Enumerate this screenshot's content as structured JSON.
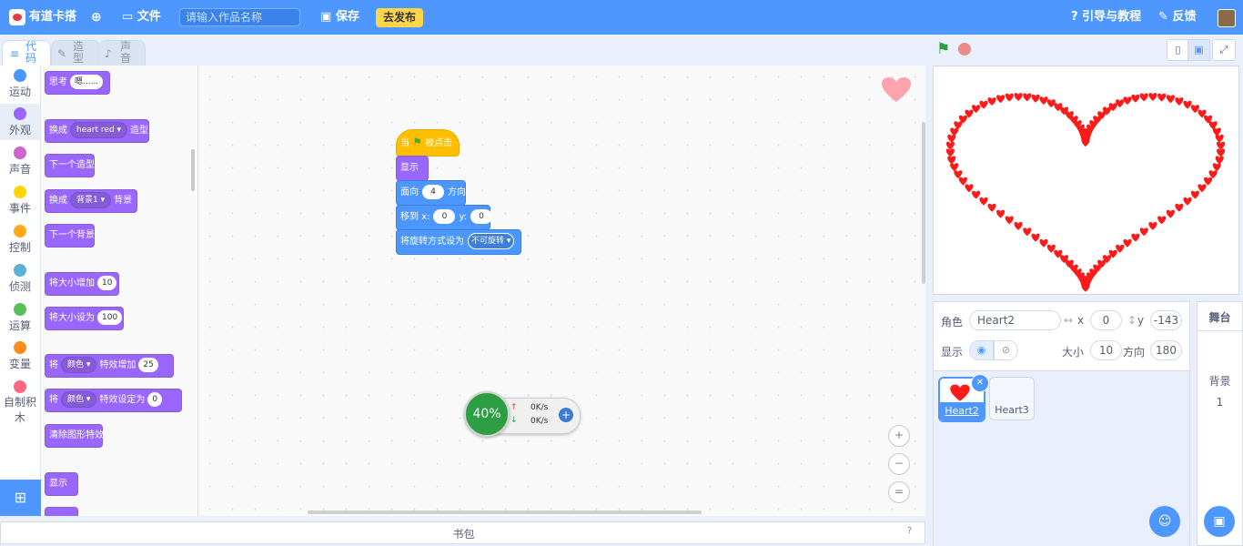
{
  "header": {
    "brand": "有道卡搭",
    "file_menu": "文件",
    "title_placeholder": "请输入作品名称",
    "save_label": "保存",
    "publish_label": "去发布",
    "tutorial_label": "引导与教程",
    "feedback_label": "反馈"
  },
  "tabs": [
    {
      "label": "代码"
    },
    {
      "label": "造型"
    },
    {
      "label": "声音"
    }
  ],
  "categories": [
    {
      "label": "运动",
      "color": "#4c97ff"
    },
    {
      "label": "外观",
      "color": "#9966ff"
    },
    {
      "label": "声音",
      "color": "#cf63cf"
    },
    {
      "label": "事件",
      "color": "#ffd500"
    },
    {
      "label": "控制",
      "color": "#ffab19"
    },
    {
      "label": "侦测",
      "color": "#5cb1d6"
    },
    {
      "label": "运算",
      "color": "#59c059"
    },
    {
      "label": "变量",
      "color": "#ff8c1a"
    },
    {
      "label": "自制积木",
      "color": "#ff6680"
    }
  ],
  "palette": {
    "think": {
      "text": "思考",
      "arg": "嗯......"
    },
    "switch_costume": {
      "text": "换成",
      "arg": "heart red",
      "suffix": "造型"
    },
    "next_costume": "下一个造型",
    "switch_backdrop": {
      "text": "换成",
      "arg": "背景1",
      "suffix": "背景"
    },
    "next_backdrop": "下一个背景",
    "change_size": {
      "text": "将大小增加",
      "arg": "10"
    },
    "set_size": {
      "text": "将大小设为",
      "arg": "100"
    },
    "change_effect": {
      "text": "将",
      "arg": "颜色",
      "suffix": "特效增加",
      "value": "25"
    },
    "set_effect": {
      "text": "将",
      "arg": "颜色",
      "suffix": "特效设定为",
      "value": "0"
    },
    "clear_effects": "清除图形特效",
    "show": "显示"
  },
  "script": {
    "hat": {
      "prefix": "当",
      "suffix": "被点击"
    },
    "show": "显示",
    "point": {
      "text": "面向",
      "value": "4",
      "suffix": "方向"
    },
    "goto": {
      "text": "移到 x:",
      "x": "0",
      "ylabel": "y:",
      "y": "0"
    },
    "rotation": {
      "text": "将旋转方式设为",
      "value": "不可旋转"
    }
  },
  "net_widget": {
    "percent": "40%",
    "up": "0K/s",
    "down": "0K/s"
  },
  "zoom": {
    "in": "+",
    "out": "−",
    "reset": "="
  },
  "backpack": {
    "label": "书包"
  },
  "sprite_info": {
    "sprite_label": "角色",
    "name": "Heart2",
    "x_label": "x",
    "x": "0",
    "y_label": "y",
    "y": "-143",
    "show_label": "显示",
    "size_label": "大小",
    "size": "10",
    "direction_label": "方向",
    "direction": "180"
  },
  "sprites": [
    {
      "name": "Heart2",
      "selected": true
    },
    {
      "name": "Heart3",
      "selected": false
    }
  ],
  "stage_panel": {
    "title": "舞台",
    "backdrop_label": "背景",
    "backdrop_count": "1"
  },
  "colors": {
    "accent": "#4d97ff",
    "looks": "#9966ff",
    "event": "#ffbf00",
    "heart": "#ff1a1a"
  }
}
